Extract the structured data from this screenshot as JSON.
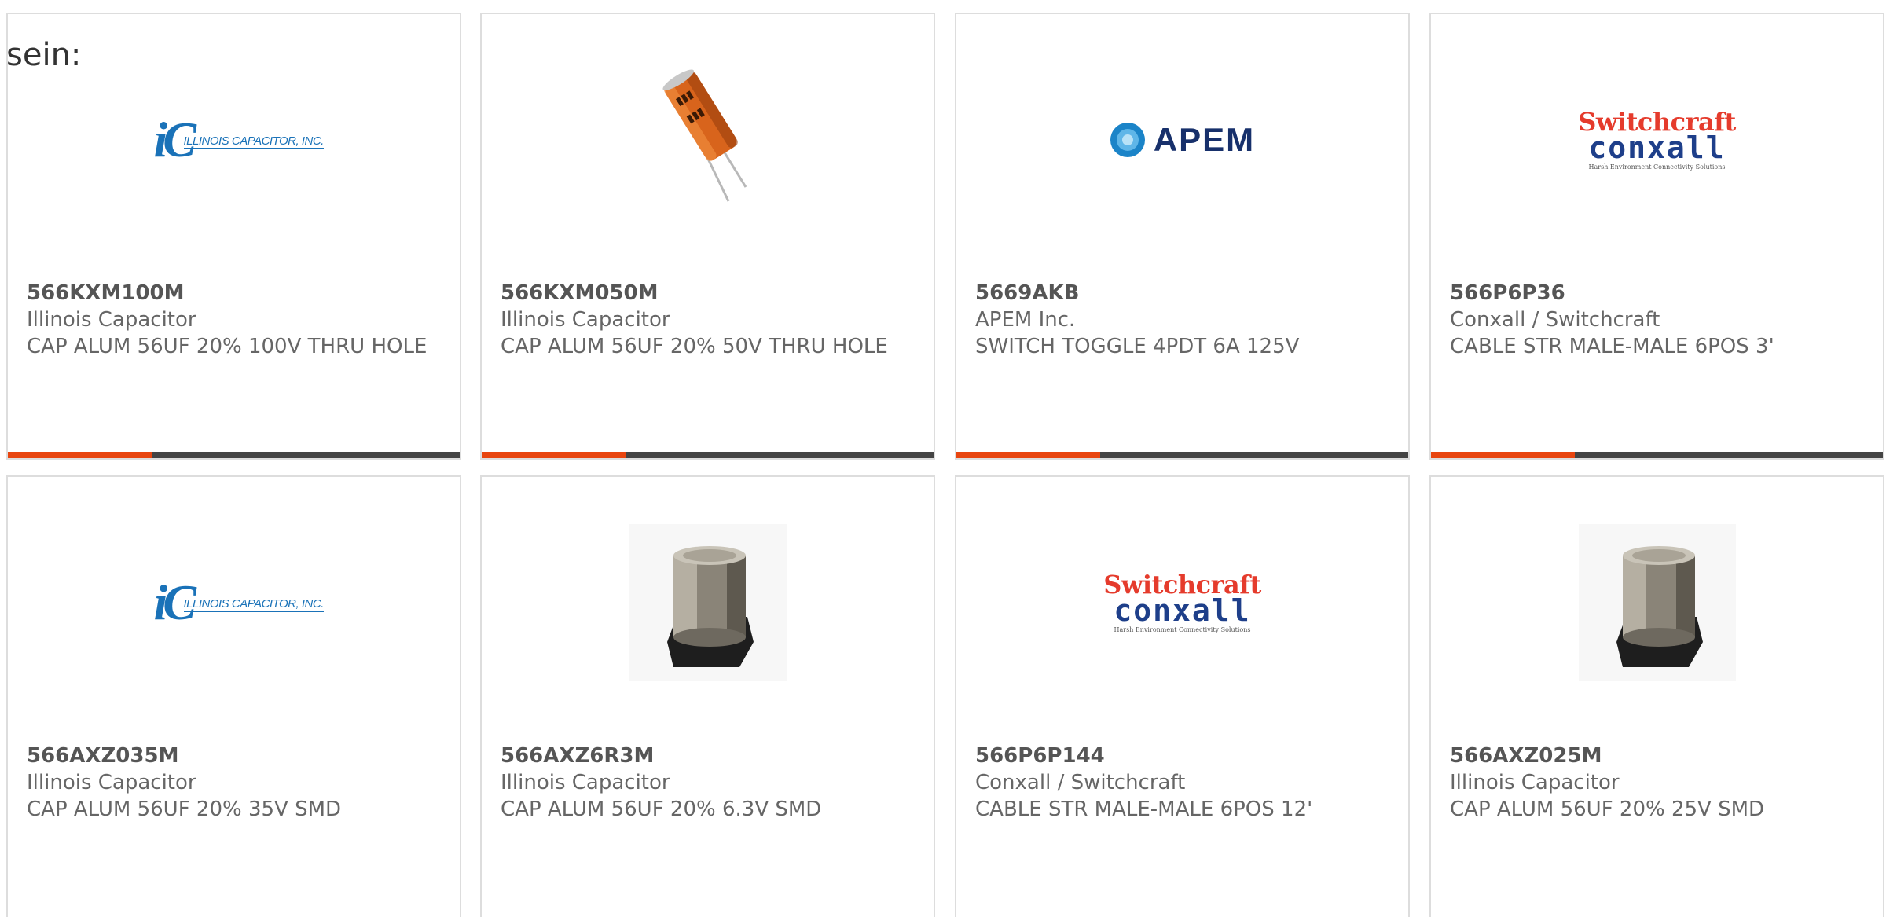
{
  "intro_text": "sein:",
  "brand_colors": {
    "accent": "#e8450f",
    "bar": "#444444",
    "border": "#dddddd",
    "text": "#666666"
  },
  "cards": [
    {
      "part": "566KXM100M",
      "manufacturer": "Illinois Capacitor",
      "description": "CAP ALUM 56UF 20% 100V THRU HOLE",
      "image": "illinois-capacitor-logo",
      "logo_text": "ILLINOIS CAPACITOR, INC."
    },
    {
      "part": "566KXM050M",
      "manufacturer": "Illinois Capacitor",
      "description": "CAP ALUM 56UF 20% 50V THRU HOLE",
      "image": "radial-capacitor-photo"
    },
    {
      "part": "5669AKB",
      "manufacturer": "APEM Inc.",
      "description": "SWITCH TOGGLE 4PDT 6A 125V",
      "image": "apem-logo",
      "logo_text": "APEM"
    },
    {
      "part": "566P6P36",
      "manufacturer": "Conxall / Switchcraft",
      "description": "CABLE STR MALE-MALE 6POS 3'",
      "image": "switchcraft-conxall-logo",
      "logo_line1": "Switchcraft",
      "logo_line2": "conxall",
      "logo_tagline": "Harsh Environment Connectivity Solutions"
    },
    {
      "part": "566AXZ035M",
      "manufacturer": "Illinois Capacitor",
      "description": "CAP ALUM 56UF 20% 35V SMD",
      "image": "illinois-capacitor-logo",
      "logo_text": "ILLINOIS CAPACITOR, INC."
    },
    {
      "part": "566AXZ6R3M",
      "manufacturer": "Illinois Capacitor",
      "description": "CAP ALUM 56UF 20% 6.3V SMD",
      "image": "smd-capacitor-photo"
    },
    {
      "part": "566P6P144",
      "manufacturer": "Conxall / Switchcraft",
      "description": "CABLE STR MALE-MALE 6POS 12'",
      "image": "switchcraft-conxall-logo",
      "logo_line1": "Switchcraft",
      "logo_line2": "conxall",
      "logo_tagline": "Harsh Environment Connectivity Solutions"
    },
    {
      "part": "566AXZ025M",
      "manufacturer": "Illinois Capacitor",
      "description": "CAP ALUM 56UF 20% 25V SMD",
      "image": "smd-capacitor-photo"
    }
  ]
}
